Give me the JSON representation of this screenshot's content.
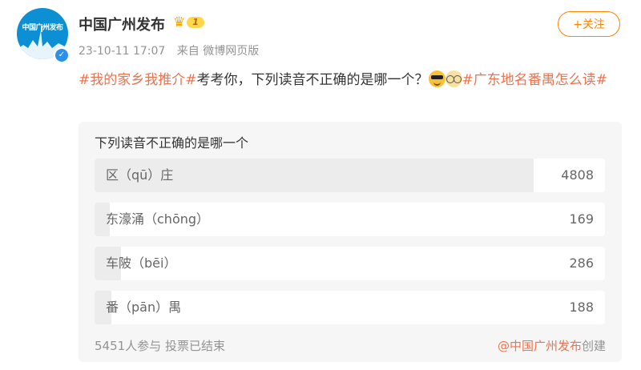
{
  "author": {
    "avatar_text": "中国广州发布",
    "name": "中国广州发布",
    "vip_level": "1",
    "verified_icon": "check"
  },
  "meta": {
    "time": "23-10-11 17:07",
    "source": "来自 微博网页版"
  },
  "follow_label": "+关注",
  "post": {
    "topic1": "#我的家乡我推介#",
    "text": "考考你，下列读音不正确的是哪一个？",
    "topic2": "#广东地名番禺怎么读#"
  },
  "poll": {
    "question": "下列读音不正确的是哪一个",
    "options": [
      {
        "label": "区（qū）庄",
        "votes": 4808,
        "count_text": "4808"
      },
      {
        "label": "东濠涌（chōng）",
        "votes": 169,
        "count_text": "169"
      },
      {
        "label": "车陂（bēi）",
        "votes": 286,
        "count_text": "286"
      },
      {
        "label": "番（pān）禺",
        "votes": 188,
        "count_text": "188"
      }
    ],
    "summary": "5451人参与 投票已结束",
    "creator": "@中国广州发布",
    "creator_suffix": "创建"
  },
  "colors": {
    "accent": "#ff8200",
    "topic": "#eb7350",
    "muted": "#939393",
    "card_bg": "#f6f6f6",
    "poll_fill": "#ececec"
  }
}
